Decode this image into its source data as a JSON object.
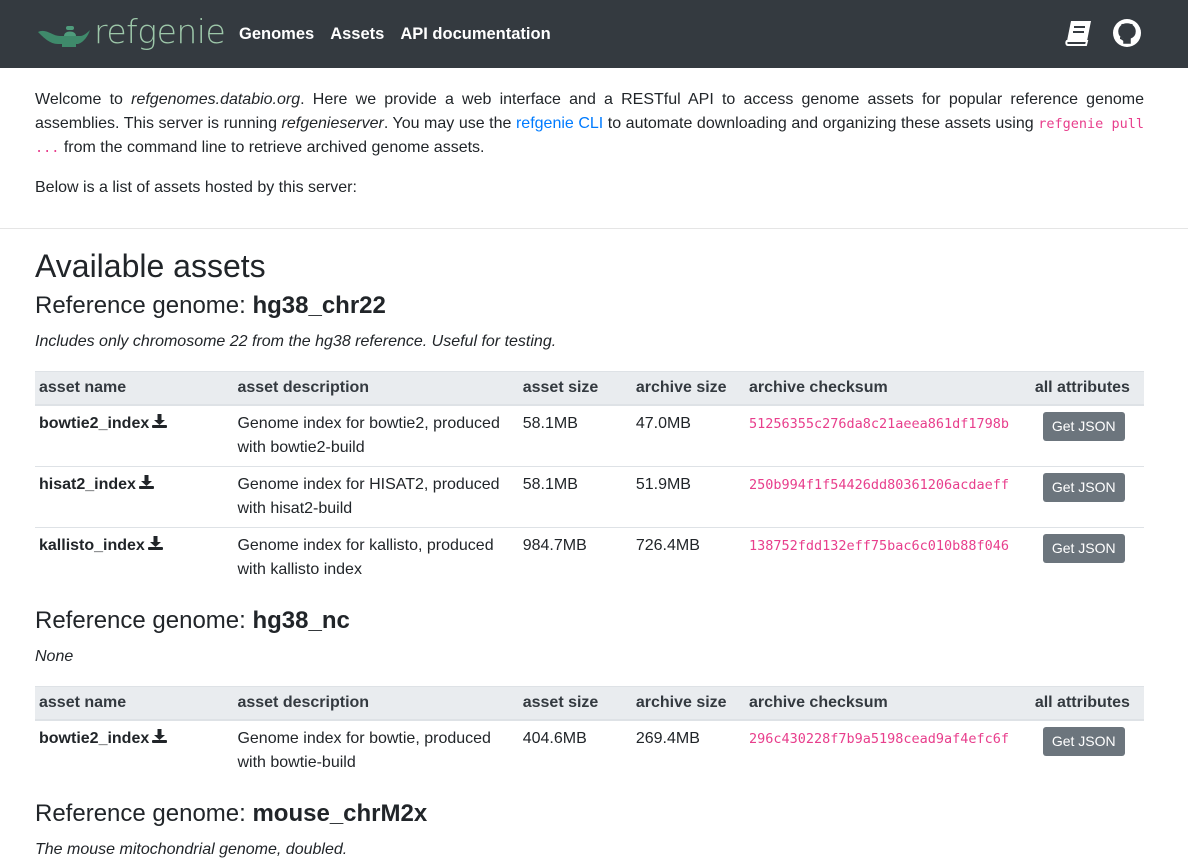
{
  "nav": {
    "brand": "refgenie",
    "links": [
      "Genomes",
      "Assets",
      "API documentation"
    ],
    "icons": [
      "book-icon",
      "github-icon"
    ],
    "brand_color": "#9dc7a9"
  },
  "intro": {
    "p1_a": "Welcome to ",
    "p1_site": "refgenomes.databio.org",
    "p1_b": ". Here we provide a web interface and a RESTful API to access genome assets for popular reference genome assemblies. This server is running ",
    "p1_server": "refgenieserver",
    "p1_c": ". You may use the ",
    "p1_link": "refgenie CLI",
    "p1_d": " to automate downloading and organizing these assets using ",
    "p1_code": "refgenie pull ...",
    "p1_e": " from the command line to retrieve archived genome assets.",
    "p2": "Below is a list of assets hosted by this server:"
  },
  "title": "Available assets",
  "genome_prefix": "Reference genome: ",
  "headers": [
    "asset name",
    "asset description",
    "asset size",
    "archive size",
    "archive checksum",
    "all attributes"
  ],
  "button_label": "Get JSON",
  "genomes": [
    {
      "name": "hg38_chr22",
      "description": "Includes only chromosome 22 from the hg38 reference. Useful for testing.",
      "assets": [
        {
          "name": "bowtie2_index",
          "description": "Genome index for bowtie2, produced with bowtie2-build",
          "asset_size": "58.1MB",
          "archive_size": "47.0MB",
          "checksum": "51256355c276da8c21aeea861df1798b"
        },
        {
          "name": "hisat2_index",
          "description": "Genome index for HISAT2, produced with hisat2-build",
          "asset_size": "58.1MB",
          "archive_size": "51.9MB",
          "checksum": "250b994f1f54426dd80361206acdaeff"
        },
        {
          "name": "kallisto_index",
          "description": "Genome index for kallisto, produced with kallisto index",
          "asset_size": "984.7MB",
          "archive_size": "726.4MB",
          "checksum": "138752fdd132eff75bac6c010b88f046"
        }
      ]
    },
    {
      "name": "hg38_nc",
      "description": "None",
      "assets": [
        {
          "name": "bowtie2_index",
          "description": "Genome index for bowtie, produced with bowtie-build",
          "asset_size": "404.6MB",
          "archive_size": "269.4MB",
          "checksum": "296c430228f7b9a5198cead9af4efc6f"
        }
      ]
    },
    {
      "name": "mouse_chrM2x",
      "description": "The mouse mitochondrial genome, doubled.",
      "assets": []
    }
  ]
}
